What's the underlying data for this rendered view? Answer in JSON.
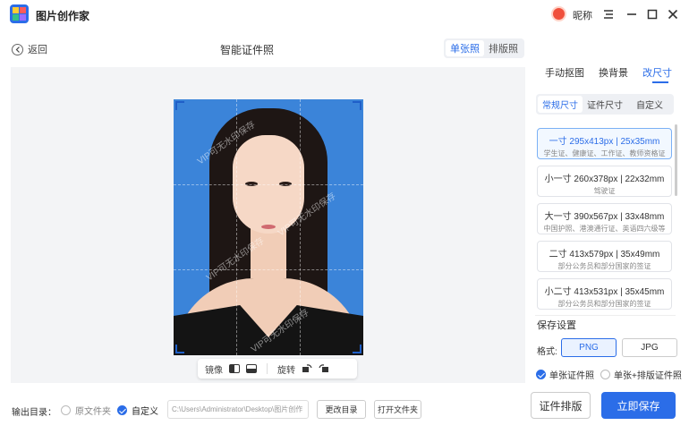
{
  "app": {
    "title": "图片创作家",
    "nickname": "昵称"
  },
  "header": {
    "back_label": "返回",
    "page_title": "智能证件照",
    "modes": [
      "单张照",
      "排版照"
    ]
  },
  "canvas": {
    "watermark": "VIP可无水印保存"
  },
  "tools": {
    "mirror_label": "镜像",
    "rotate_label": "旋转"
  },
  "output": {
    "label": "输出目录：",
    "option_original": "原文件夹",
    "option_custom": "自定义",
    "path_value": "C:\\Users\\Administrator\\Desktop\\图片创作",
    "change_dir": "更改目录",
    "open_folder": "打开文件夹"
  },
  "right_tabs": [
    "手动抠图",
    "换背景",
    "改尺寸"
  ],
  "size_tabs": [
    "常规尺寸",
    "证件尺寸",
    "自定义"
  ],
  "sizes": [
    {
      "title": "一寸 295x413px | 25x35mm",
      "desc": "学生证、健康证、工作证、教师资格证"
    },
    {
      "title": "小一寸 260x378px | 22x32mm",
      "desc": "驾驶证"
    },
    {
      "title": "大一寸 390x567px | 33x48mm",
      "desc": "中国护照、港澳通行证、英语四六级等"
    },
    {
      "title": "二寸 413x579px | 35x49mm",
      "desc": "部分公务员和部分国家的签证"
    },
    {
      "title": "小二寸 413x531px | 35x45mm",
      "desc": "部分公务员和部分国家的签证"
    }
  ],
  "save": {
    "heading": "保存设置",
    "format_label": "格式:",
    "formats": [
      "PNG",
      "JPG"
    ],
    "mode_single": "单张证件照",
    "mode_both": "单张+排版证件照"
  },
  "actions": {
    "layout": "证件排版",
    "save_now": "立即保存"
  },
  "colors": {
    "accent": "#2b6de8",
    "photo_bg": "#3b84d9"
  }
}
